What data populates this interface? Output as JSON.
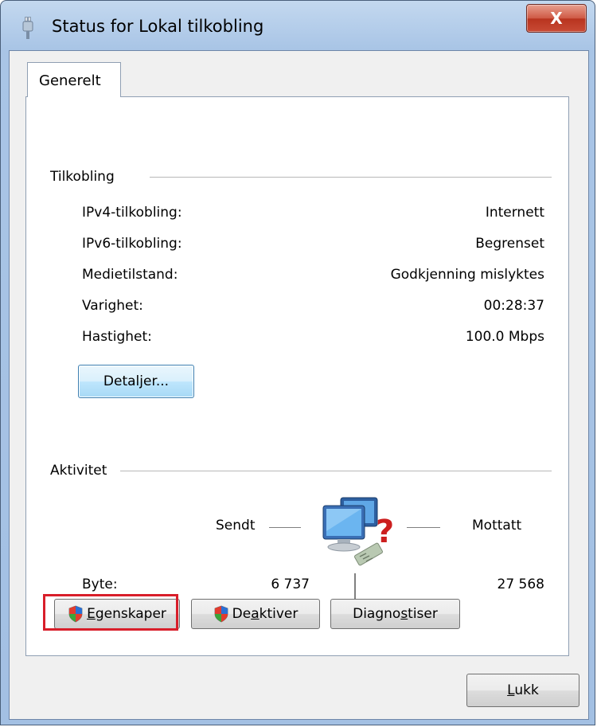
{
  "window": {
    "title": "Status for Lokal tilkobling",
    "close_glyph": "X"
  },
  "tabs": [
    {
      "label": "Generelt"
    }
  ],
  "connection": {
    "group_label": "Tilkobling",
    "rows": [
      {
        "label": "IPv4-tilkobling:",
        "value": "Internett"
      },
      {
        "label": "IPv6-tilkobling:",
        "value": "Begrenset"
      },
      {
        "label": "Medietilstand:",
        "value": "Godkjenning mislyktes"
      },
      {
        "label": "Varighet:",
        "value": "00:28:37"
      },
      {
        "label": "Hastighet:",
        "value": "100.0 Mbps"
      }
    ],
    "details_button": "Detaljer..."
  },
  "activity": {
    "group_label": "Aktivitet",
    "sent_label": "Sendt",
    "received_label": "Mottatt",
    "bytes_label": "Byte:",
    "bytes_sent": "6 737",
    "bytes_received": "27 568",
    "icon": "network-computer-unknown-icon"
  },
  "actions": {
    "properties": {
      "label_first": "E",
      "label_rest": "genskaper",
      "icon": "uac-shield-icon"
    },
    "disable": {
      "label_pre": "De",
      "label_underline": "a",
      "label_post": "ktiver",
      "icon": "uac-shield-icon"
    },
    "diagnose": {
      "label_pre": "Diagno",
      "label_underline": "s",
      "label_post": "tiser"
    }
  },
  "footer": {
    "close_first": "L",
    "close_rest": "ukk"
  },
  "colors": {
    "highlight": "#d81e2a",
    "titlebar": "#a9c5e6",
    "close_button": "#c84a35"
  }
}
